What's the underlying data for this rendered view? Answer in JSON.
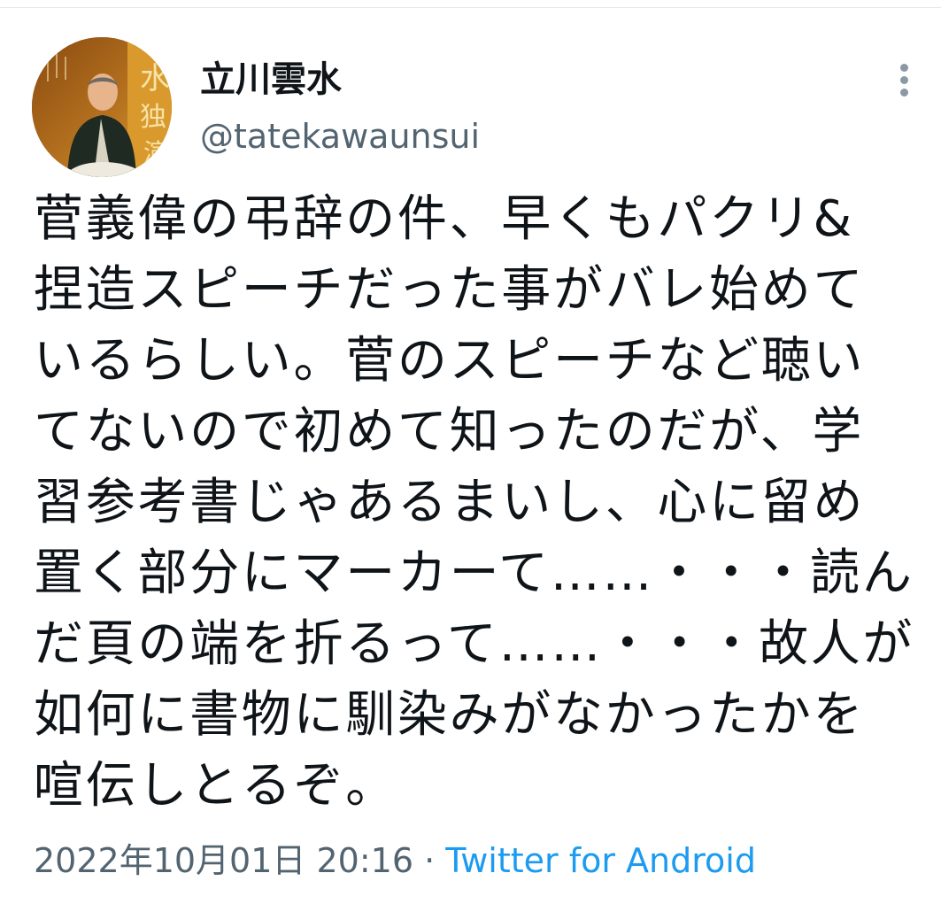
{
  "user": {
    "display_name": "立川雲水",
    "handle": "@tatekawaunsui"
  },
  "tweet": {
    "text": "菅義偉の弔辞の件、早くもパクリ&\n捏造スピーチだった事がバレ始めて\nいるらしい。菅のスピーチなど聴い\nてないので初めて知ったのだが、学\n習参考書じゃあるまいし、心に留め\n置く部分にマーカーて……・・・読ん\nだ頁の端を折るって……・・・故人が\n如何に書物に馴染みがなかったかを\n喧伝しとるぞ。",
    "timestamp": "2022年10月01日 20:16",
    "separator": " · ",
    "source": "Twitter for Android"
  },
  "avatar": {
    "poster_text": [
      "水",
      "独",
      "演"
    ]
  },
  "icons": {
    "more": "more-vertical-icon"
  },
  "colors": {
    "text": "#0f1419",
    "secondary": "#536471",
    "link": "#1d9bf0",
    "icon": "#8b98a5"
  }
}
